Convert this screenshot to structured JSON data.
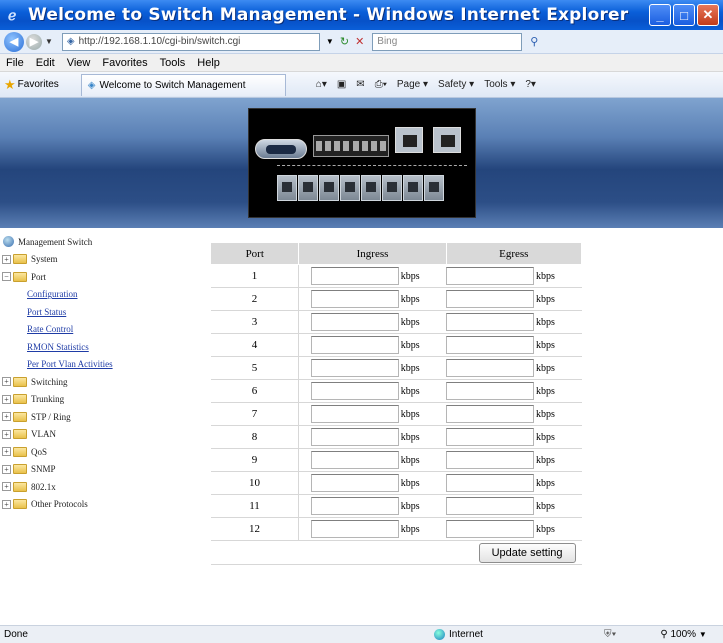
{
  "window": {
    "title": "Welcome to Switch Management - Windows Internet Explorer",
    "buttons": {
      "minimize": "_",
      "maximize": "□",
      "close": "✕"
    }
  },
  "address_bar": {
    "url": "http://192.168.1.10/cgi-bin/switch.cgi",
    "search_placeholder": "Bing",
    "refresh_symbol": "↻",
    "stop_symbol": "✕"
  },
  "menu": [
    "File",
    "Edit",
    "View",
    "Favorites",
    "Tools",
    "Help"
  ],
  "favorites_bar": {
    "favorites_label": "Favorites",
    "tab_title": "Welcome to Switch Management",
    "commands": [
      "Page ▾",
      "Safety ▾",
      "Tools ▾"
    ]
  },
  "tree": {
    "root": "Management Switch",
    "items": [
      {
        "label": "System",
        "level": 1,
        "expander": "+"
      },
      {
        "label": "Port",
        "level": 1,
        "expander": "−"
      },
      {
        "label": "Configuration",
        "level": 2
      },
      {
        "label": "Port Status",
        "level": 2
      },
      {
        "label": "Rate Control",
        "level": 2
      },
      {
        "label": "RMON Statistics",
        "level": 2
      },
      {
        "label": "Per Port Vlan Activities",
        "level": 2
      },
      {
        "label": "Switching",
        "level": 1,
        "expander": "+"
      },
      {
        "label": "Trunking",
        "level": 1,
        "expander": "+"
      },
      {
        "label": "STP / Ring",
        "level": 1,
        "expander": "+"
      },
      {
        "label": "VLAN",
        "level": 1,
        "expander": "+"
      },
      {
        "label": "QoS",
        "level": 1,
        "expander": "+"
      },
      {
        "label": "SNMP",
        "level": 1,
        "expander": "+"
      },
      {
        "label": "802.1x",
        "level": 1,
        "expander": "+"
      },
      {
        "label": "Other Protocols",
        "level": 1,
        "expander": "+"
      }
    ]
  },
  "rate_table": {
    "headers": {
      "port": "Port",
      "ingress": "Ingress",
      "egress": "Egress"
    },
    "unit": "kbps",
    "ports": [
      "1",
      "2",
      "3",
      "4",
      "5",
      "6",
      "7",
      "8",
      "9",
      "10",
      "11",
      "12"
    ],
    "update_button": "Update setting"
  },
  "status_bar": {
    "left": "Done",
    "zone": "Internet",
    "zoom": "100%"
  }
}
